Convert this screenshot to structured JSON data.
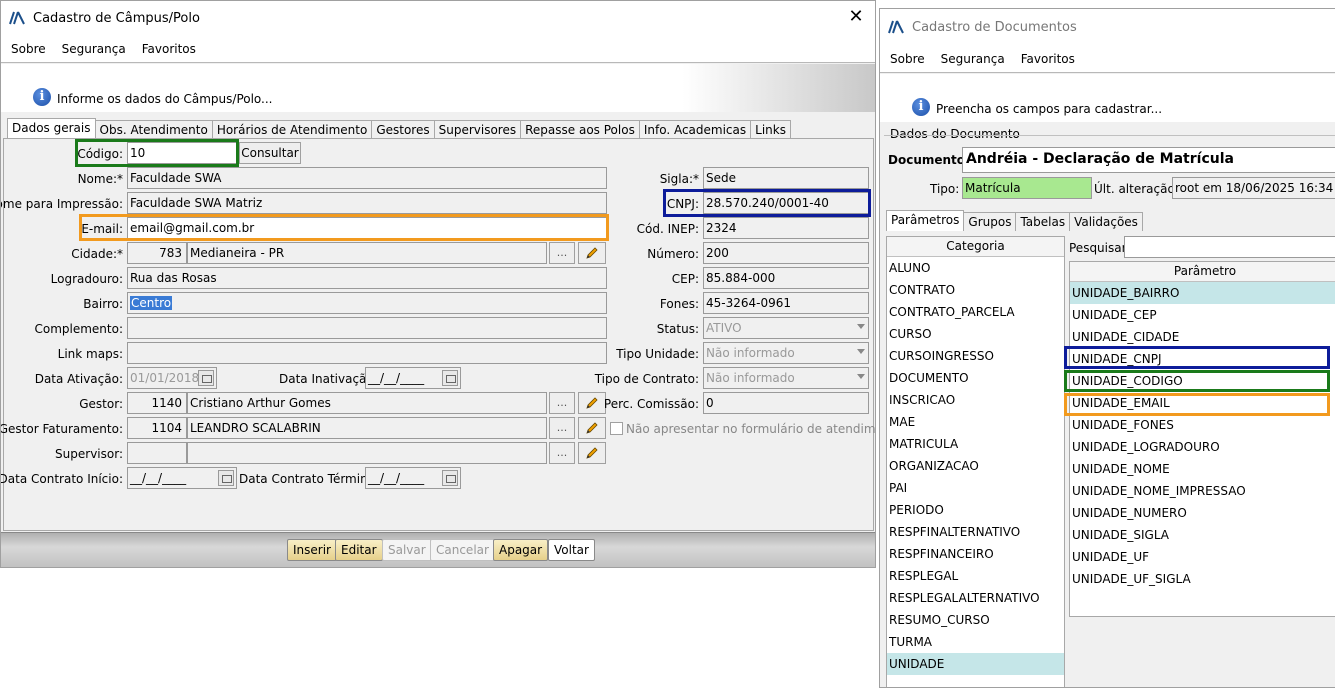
{
  "win1": {
    "title": "Cadastro de Câmpus/Polo",
    "close": "✕",
    "menu": [
      "Sobre",
      "Segurança",
      "Favoritos"
    ],
    "info": "Informe os dados do Câmpus/Polo...",
    "tabs": [
      "Dados gerais",
      "Obs. Atendimento",
      "Horários de Atendimento",
      "Gestores",
      "Supervisores",
      "Repasse aos Polos",
      "Info. Academicas",
      "Links"
    ],
    "labels": {
      "codigo": "Código:",
      "nome": "Nome:*",
      "nome_impressao": "Nome para Impressão:",
      "email": "E-mail:",
      "cidade": "Cidade:*",
      "logradouro": "Logradouro:",
      "bairro": "Bairro:",
      "complemento": "Complemento:",
      "link_maps": "Link maps:",
      "data_ativacao": "Data Ativação:",
      "data_inativacao": "Data Inativação:",
      "gestor": "Gestor:",
      "gestor_faturamento": "Gestor Faturamento:",
      "supervisor": "Supervisor:",
      "data_contrato_inicio": "Data Contrato Início:",
      "data_contrato_termino": "Data Contrato Término:",
      "sigla": "Sigla:*",
      "cnpj": "CNPJ:",
      "cod_inep": "Cód. INEP:",
      "numero": "Número:",
      "cep": "CEP:",
      "fones": "Fones:",
      "status": "Status:",
      "tipo_unidade": "Tipo Unidade:",
      "tipo_contrato": "Tipo de Contrato:",
      "perc_comissao": "Perc. Comissão:",
      "nao_apresentar": "Não apresentar no formulário de atendimento"
    },
    "values": {
      "codigo": "10",
      "nome": "Faculdade SWA",
      "nome_impressao": "Faculdade SWA Matriz",
      "email": "email@gmail.com.br",
      "cidade_cod": "783",
      "cidade_nome": "Medianeira - PR",
      "logradouro": "Rua das Rosas",
      "bairro": "Centro",
      "complemento": "",
      "link_maps": "",
      "data_ativacao": "01/01/2018",
      "data_inativacao": "__/__/____",
      "gestor_cod": "1140",
      "gestor_nome": "Cristiano Arthur Gomes",
      "gestor_fat_cod": "1104",
      "gestor_fat_nome": "LEANDRO SCALABRIN",
      "supervisor_cod": "",
      "supervisor_nome": "",
      "data_contrato_inicio": "__/__/____",
      "data_contrato_termino": "__/__/____",
      "sigla": "Sede",
      "cnpj": "28.570.240/0001-40",
      "cod_inep": "2324",
      "numero": "200",
      "cep": "85.884-000",
      "fones": "45-3264-0961",
      "status": "ATIVO",
      "tipo_unidade": "Não informado",
      "tipo_contrato": "Não informado",
      "perc_comissao": "0"
    },
    "consultar": "Consultar",
    "dots": "...",
    "buttons": {
      "inserir": "Inserir",
      "editar": "Editar",
      "salvar": "Salvar",
      "cancelar": "Cancelar",
      "apagar": "Apagar",
      "voltar": "Voltar"
    }
  },
  "win2": {
    "title": "Cadastro de Documentos",
    "menu": [
      "Sobre",
      "Segurança",
      "Favoritos"
    ],
    "info": "Preencha os campos para cadastrar...",
    "group_title": "Dados do Documento",
    "documento_label": "Documento:",
    "documento_value": "Andréia - Declaração de Matrícula",
    "tipo_label": "Tipo:",
    "tipo_value": "Matrícula",
    "ult_alteracao_label": "Últ. alteração:",
    "ult_alteracao_value": "root em 18/06/2025 16:34",
    "tabs": [
      "Parâmetros",
      "Grupos",
      "Tabelas",
      "Validações"
    ],
    "categoria_header": "Categoria",
    "categorias": [
      "ALUNO",
      "CONTRATO",
      "CONTRATO_PARCELA",
      "CURSO",
      "CURSOINGRESSO",
      "DOCUMENTO",
      "INSCRICAO",
      "MAE",
      "MATRICULA",
      "ORGANIZACAO",
      "PAI",
      "PERIODO",
      "RESPFINALTERNATIVO",
      "RESPFINANCEIRO",
      "RESPLEGAL",
      "RESPLEGALALTERNATIVO",
      "RESUMO_CURSO",
      "TURMA",
      "UNIDADE"
    ],
    "categoria_selected": "UNIDADE",
    "pesquisar_label": "Pesquisar:",
    "pesquisar_value": "",
    "parametro_header": "Parâmetro",
    "parametros": [
      "UNIDADE_BAIRRO",
      "UNIDADE_CEP",
      "UNIDADE_CIDADE",
      "UNIDADE_CNPJ",
      "UNIDADE_CODIGO",
      "UNIDADE_EMAIL",
      "UNIDADE_FONES",
      "UNIDADE_LOGRADOURO",
      "UNIDADE_NOME",
      "UNIDADE_NOME_IMPRESSAO",
      "UNIDADE_NUMERO",
      "UNIDADE_SIGLA",
      "UNIDADE_UF",
      "UNIDADE_UF_SIGLA"
    ],
    "parametro_selected": "UNIDADE_BAIRRO"
  },
  "colors": {
    "highlight_green": "#1a7a1a",
    "highlight_orange": "#f29a1e",
    "highlight_navy": "#0d1c9a",
    "tipo_green": "#a8e890",
    "selected_row": "#c5e6e8"
  }
}
